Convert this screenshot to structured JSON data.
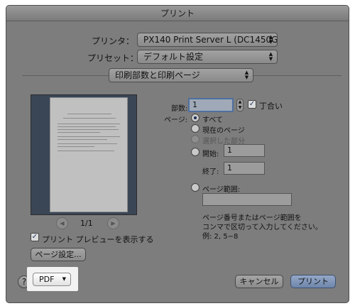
{
  "window": {
    "title": "プリント"
  },
  "printer": {
    "label": "プリンタ：",
    "value": "PX140 Print Server L (DC1450G..."
  },
  "preset": {
    "label": "プリセット：",
    "value": "デフォルト設定"
  },
  "section_popup": {
    "value": "印刷部数と印刷ページ"
  },
  "preview": {
    "page_indicator": "1/1",
    "show_preview_label": "プリント プレビューを表示する",
    "page_setup_button": "ページ設定..."
  },
  "copies": {
    "label": "部数:",
    "value": "1",
    "collate_label": "丁合い"
  },
  "pages": {
    "label": "ページ:",
    "all_label": "すべて",
    "current_label": "現在のページ",
    "selection_label": "選択した部分",
    "from_label": "開始:",
    "from_value": "1",
    "to_label": "終了:",
    "to_value": "1",
    "range_label": "ページ範囲:",
    "range_value": "",
    "hint_line1": "ページ番号またはページ範囲を",
    "hint_line2": "コンマで区切って入力してください。",
    "example": "例: 2, 5−8"
  },
  "footer": {
    "help": "?",
    "pdf_label": "PDF",
    "cancel": "キャンセル",
    "print": "プリント"
  },
  "icons": {
    "popup_arrows": "⬍",
    "pdf_arrow": "▼",
    "nav_prev": "◀",
    "nav_next": "▶",
    "check": "✓",
    "stepper": "▲▼"
  }
}
